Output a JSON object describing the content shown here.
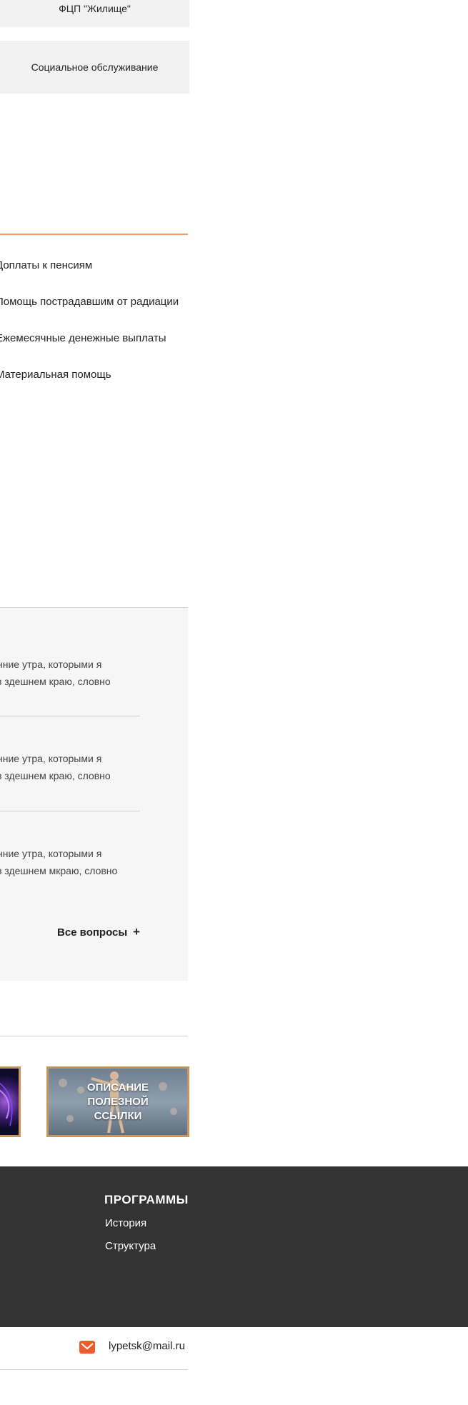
{
  "menu": {
    "top_item": "ФЦП \"Жилище\"",
    "social_item": "Социальное обслуживание"
  },
  "links": [
    "Доплаты к пенсиям",
    "Помощь пострадавшим от радиации",
    "Ежемесячные денежные выплаты",
    "Материальная помощь"
  ],
  "faq": {
    "items": [
      {
        "line1": "нние утра, которыми я",
        "line2": "з здешнем краю, словно"
      },
      {
        "line1": "нние утра, которыми я",
        "line2": "з здешнем краю, словно"
      },
      {
        "line1": "нние утра, которыми я",
        "line2": "з здешнем мкраю, словно"
      }
    ],
    "all_label": "Все вопросы",
    "plus": "+"
  },
  "banner": {
    "text_line1": "ОПИСАНИЕ",
    "text_line2": "ПОЛЕЗНОЙ",
    "text_line3": "ССЫЛКИ"
  },
  "footer": {
    "title": "ПРОГРАММЫ",
    "links": [
      "История",
      "Структура"
    ]
  },
  "contact": {
    "email": "lypetsk@mail.ru",
    "icon": "mail-icon"
  },
  "colors": {
    "accent": "#ef9a5c",
    "footer_bg": "#333333",
    "banner_border": "#c9955a",
    "mail_icon": "#f05a28"
  }
}
